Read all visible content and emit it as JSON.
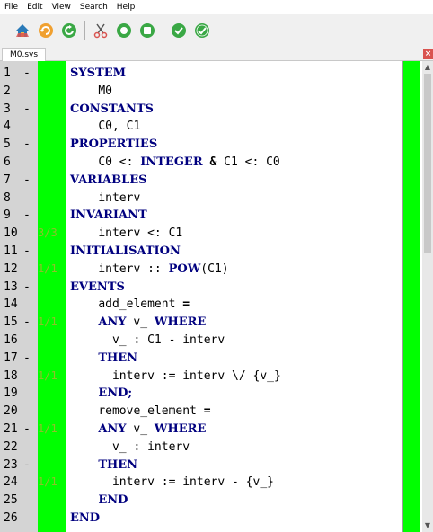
{
  "menu": [
    "File",
    "Edit",
    "View",
    "Search",
    "Help"
  ],
  "toolbar": {
    "icons": [
      "home-icon",
      "undo-icon",
      "refresh-icon",
      "cut-icon",
      "record-icon-1",
      "record-icon-2",
      "check-icon-1",
      "check-icon-2"
    ]
  },
  "tab": {
    "label": "M0.sys",
    "close": "×"
  },
  "editor": {
    "lines": [
      {
        "num": "1",
        "marker": "-",
        "proof": "",
        "indent": "",
        "tokens": [
          {
            "t": "SYSTEM",
            "k": "kw"
          }
        ]
      },
      {
        "num": "2",
        "marker": "",
        "proof": "",
        "indent": "    ",
        "tokens": [
          {
            "t": "M0",
            "k": ""
          }
        ]
      },
      {
        "num": "3",
        "marker": "-",
        "proof": "",
        "indent": "",
        "tokens": [
          {
            "t": "CONSTANTS",
            "k": "kw"
          }
        ]
      },
      {
        "num": "4",
        "marker": "",
        "proof": "",
        "indent": "    ",
        "tokens": [
          {
            "t": "C0, C1",
            "k": ""
          }
        ]
      },
      {
        "num": "5",
        "marker": "-",
        "proof": "",
        "indent": "",
        "tokens": [
          {
            "t": "PROPERTIES",
            "k": "kw"
          }
        ]
      },
      {
        "num": "6",
        "marker": "",
        "proof": "",
        "indent": "    ",
        "tokens": [
          {
            "t": "C0 <: ",
            "k": ""
          },
          {
            "t": "INTEGER",
            "k": "kw"
          },
          {
            "t": " & ",
            "k": "sym"
          },
          {
            "t": "C1 <: C0",
            "k": ""
          }
        ]
      },
      {
        "num": "7",
        "marker": "-",
        "proof": "",
        "indent": "",
        "tokens": [
          {
            "t": "VARIABLES",
            "k": "kw"
          }
        ]
      },
      {
        "num": "8",
        "marker": "",
        "proof": "",
        "indent": "    ",
        "tokens": [
          {
            "t": "interv",
            "k": ""
          }
        ]
      },
      {
        "num": "9",
        "marker": "-",
        "proof": "",
        "indent": "",
        "tokens": [
          {
            "t": "INVARIANT",
            "k": "kw"
          }
        ]
      },
      {
        "num": "10",
        "marker": "",
        "proof": "3/3",
        "indent": "    ",
        "tokens": [
          {
            "t": "interv <: C1",
            "k": ""
          }
        ]
      },
      {
        "num": "11",
        "marker": "-",
        "proof": "",
        "indent": "",
        "tokens": [
          {
            "t": "INITIALISATION",
            "k": "kw"
          }
        ]
      },
      {
        "num": "12",
        "marker": "",
        "proof": "1/1",
        "indent": "    ",
        "tokens": [
          {
            "t": "interv :: ",
            "k": ""
          },
          {
            "t": "POW",
            "k": "kw"
          },
          {
            "t": "(C1)",
            "k": ""
          }
        ]
      },
      {
        "num": "13",
        "marker": "-",
        "proof": "",
        "indent": "",
        "tokens": [
          {
            "t": "EVENTS",
            "k": "kw"
          }
        ]
      },
      {
        "num": "14",
        "marker": "",
        "proof": "",
        "indent": "    ",
        "tokens": [
          {
            "t": "add_element ",
            "k": ""
          },
          {
            "t": "=",
            "k": "sym"
          }
        ]
      },
      {
        "num": "15",
        "marker": "-",
        "proof": "1/1",
        "indent": "    ",
        "tokens": [
          {
            "t": "ANY",
            "k": "kw"
          },
          {
            "t": " v_ ",
            "k": ""
          },
          {
            "t": "WHERE",
            "k": "kw"
          }
        ]
      },
      {
        "num": "16",
        "marker": "",
        "proof": "",
        "indent": "      ",
        "tokens": [
          {
            "t": "v_ : C1 - interv",
            "k": ""
          }
        ]
      },
      {
        "num": "17",
        "marker": "-",
        "proof": "",
        "indent": "    ",
        "tokens": [
          {
            "t": "THEN",
            "k": "kw"
          }
        ]
      },
      {
        "num": "18",
        "marker": "",
        "proof": "1/1",
        "indent": "      ",
        "tokens": [
          {
            "t": "interv := interv \\/ {v_}",
            "k": ""
          }
        ]
      },
      {
        "num": "19",
        "marker": "",
        "proof": "",
        "indent": "    ",
        "tokens": [
          {
            "t": "END;",
            "k": "kw"
          }
        ]
      },
      {
        "num": "20",
        "marker": "",
        "proof": "",
        "indent": "    ",
        "tokens": [
          {
            "t": "remove_element ",
            "k": ""
          },
          {
            "t": "=",
            "k": "sym"
          }
        ]
      },
      {
        "num": "21",
        "marker": "-",
        "proof": "1/1",
        "indent": "    ",
        "tokens": [
          {
            "t": "ANY",
            "k": "kw"
          },
          {
            "t": " v_ ",
            "k": ""
          },
          {
            "t": "WHERE",
            "k": "kw"
          }
        ]
      },
      {
        "num": "22",
        "marker": "",
        "proof": "",
        "indent": "      ",
        "tokens": [
          {
            "t": "v_ : interv",
            "k": ""
          }
        ]
      },
      {
        "num": "23",
        "marker": "-",
        "proof": "",
        "indent": "    ",
        "tokens": [
          {
            "t": "THEN",
            "k": "kw"
          }
        ]
      },
      {
        "num": "24",
        "marker": "",
        "proof": "1/1",
        "indent": "      ",
        "tokens": [
          {
            "t": "interv := interv - {v_}",
            "k": ""
          }
        ]
      },
      {
        "num": "25",
        "marker": "",
        "proof": "",
        "indent": "    ",
        "tokens": [
          {
            "t": "END",
            "k": "kw"
          }
        ]
      },
      {
        "num": "26",
        "marker": "",
        "proof": "",
        "indent": "",
        "tokens": [
          {
            "t": "END",
            "k": "kw"
          }
        ]
      }
    ]
  },
  "colors": {
    "proof_green": "#00ff00",
    "keyword_navy": "#00007f",
    "gutter_gray": "#d4d4d4"
  }
}
